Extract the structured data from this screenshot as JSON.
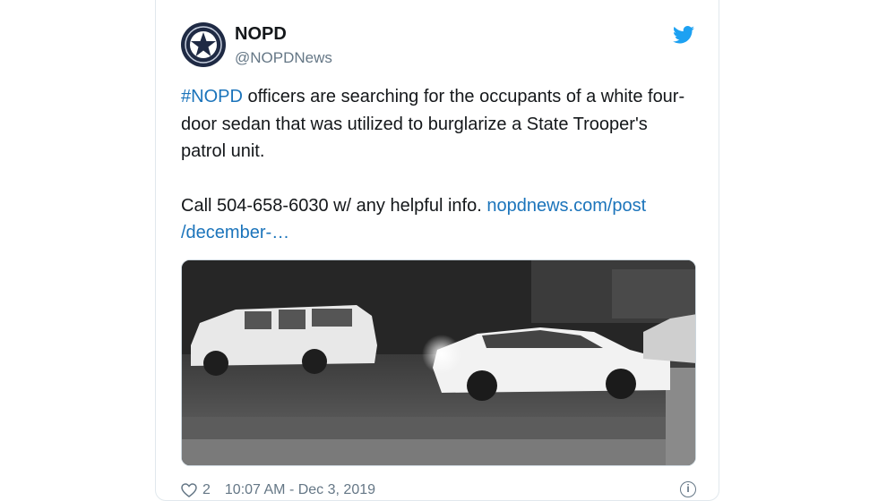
{
  "tweet": {
    "author_name": "NOPD",
    "author_handle": "@NOPDNews",
    "hashtag": "#NOPD",
    "body_line1_rest": " officers are searching for the occupants of a white four-door sedan that was utilized to burglarize a State Trooper's patrol unit.",
    "body_line2_prefix": "Call 504-658-6030 w/ any helpful info. ",
    "link_text": "nopdnews.com/post /december-…",
    "likes": "2",
    "timestamp": "10:07 AM - Dec 3, 2019"
  },
  "icons": {
    "avatar": "nopd-badge-star-icon",
    "brand": "twitter-bird-icon",
    "like": "heart-icon",
    "info": "info-icon"
  },
  "colors": {
    "link": "#1b74bb",
    "twitter_blue": "#1da1f2",
    "secondary_text": "#657786"
  }
}
